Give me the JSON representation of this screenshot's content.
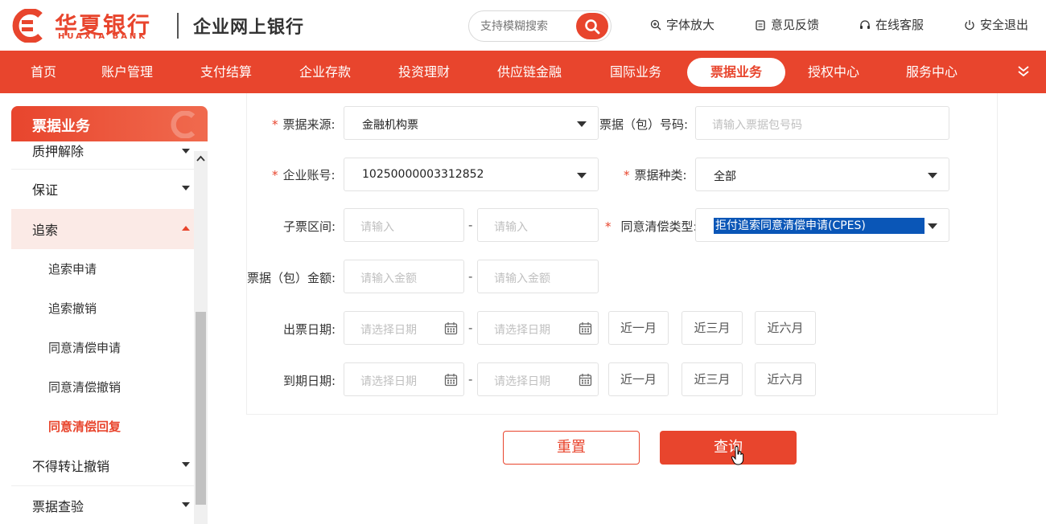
{
  "header": {
    "brand_cn": "华夏银行",
    "brand_en": "HUAXIA BANK",
    "subtitle": "企业网上银行",
    "search_placeholder": "支持模糊搜索",
    "links": {
      "font_enlarge": "字体放大",
      "feedback": "意见反馈",
      "online_service": "在线客服",
      "logout": "安全退出"
    }
  },
  "nav": {
    "items": [
      "首页",
      "账户管理",
      "支付结算",
      "企业存款",
      "投资理财",
      "供应链金融",
      "国际业务",
      "票据业务",
      "授权中心",
      "服务中心"
    ],
    "active": "票据业务"
  },
  "sidebar": {
    "title": "票据业务",
    "items": {
      "pledge_release": "质押解除",
      "guarantee": "保证",
      "recourse": "追索",
      "recourse_apply": "追索申请",
      "recourse_cancel": "追索撤销",
      "settle_apply": "同意清偿申请",
      "settle_cancel": "同意清偿撤销",
      "settle_reply": "同意清偿回复",
      "no_transfer_cancel": "不得转让撤销",
      "bill_check": "票据查验"
    }
  },
  "form": {
    "bill_source": {
      "label": "票据来源:",
      "value": "金融机构票"
    },
    "bill_no": {
      "label": "票据（包）号码:",
      "placeholder": "请输入票据包号码"
    },
    "account": {
      "label": "企业账号:",
      "value": "10250000003312852"
    },
    "bill_type": {
      "label": "票据种类:",
      "value": "全部"
    },
    "sub_range": {
      "label": "子票区间:",
      "from_placeholder": "请输入",
      "to_placeholder": "请输入"
    },
    "settle_type": {
      "label": "同意清偿类型:",
      "value": "拒付追索同意清偿申请(CPES)"
    },
    "amount": {
      "label": "票据（包）金额:",
      "from_placeholder": "请输入金额",
      "to_placeholder": "请输入金额"
    },
    "issue_date": {
      "label": "出票日期:",
      "from_placeholder": "请选择日期",
      "to_placeholder": "请选择日期"
    },
    "due_date": {
      "label": "到期日期:",
      "from_placeholder": "请选择日期",
      "to_placeholder": "请选择日期"
    },
    "quick_ranges": [
      "近一月",
      "近三月",
      "近六月"
    ],
    "range_sep": "-"
  },
  "buttons": {
    "reset": "重置",
    "query": "查询"
  },
  "colors": {
    "brand": "#e8452d",
    "selection": "#0a56b7"
  }
}
